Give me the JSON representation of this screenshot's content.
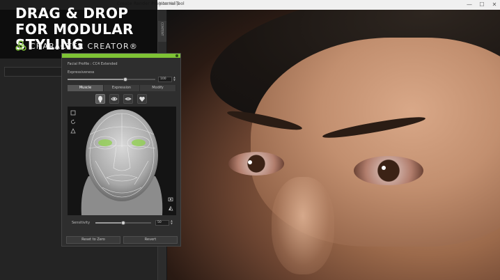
{
  "window": {
    "title": "Internal Tool",
    "menu_text": "Create  Render  Plugins  Help",
    "minimize_glyph": "—",
    "maximize_glyph": "☐",
    "close_glyph": "✕"
  },
  "sidebar_tab": {
    "label": "CONTENT"
  },
  "branding": {
    "headline_line1": "DRAG & DROP",
    "headline_line2": "FOR MODULAR STYLING",
    "product_name": "CHARACTER CREATOR",
    "trademark": "®",
    "accent_color": "#7ec335"
  },
  "facial_profile": {
    "title": "Facial Profile : CC4 Extended",
    "expressiveness": {
      "label": "Expressiveness",
      "value": "100",
      "fraction": 0.66
    },
    "tabs": [
      {
        "label": "Muscle",
        "active": true
      },
      {
        "label": "Expression",
        "active": false
      },
      {
        "label": "Modify",
        "active": false
      }
    ],
    "mode_icons": [
      "head-mode-icon",
      "eye-mode-icon",
      "mouth-mode-icon",
      "heart-face-icon"
    ],
    "sensitivity": {
      "label": "Sensitivity",
      "value": "50",
      "fraction": 0.5
    },
    "buttons": {
      "reset": "Reset to Zero",
      "revert": "Revert"
    },
    "spinner_up": "▲",
    "spinner_down": "▼"
  }
}
